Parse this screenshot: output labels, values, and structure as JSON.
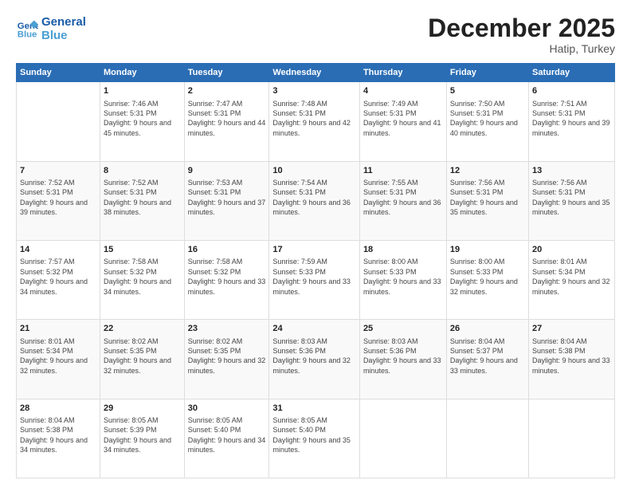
{
  "header": {
    "logo_line1": "General",
    "logo_line2": "Blue",
    "title": "December 2025",
    "subtitle": "Hatip, Turkey"
  },
  "days_of_week": [
    "Sunday",
    "Monday",
    "Tuesday",
    "Wednesday",
    "Thursday",
    "Friday",
    "Saturday"
  ],
  "weeks": [
    [
      {
        "day": "",
        "sunrise": "",
        "sunset": "",
        "daylight": ""
      },
      {
        "day": "1",
        "sunrise": "Sunrise: 7:46 AM",
        "sunset": "Sunset: 5:31 PM",
        "daylight": "Daylight: 9 hours and 45 minutes."
      },
      {
        "day": "2",
        "sunrise": "Sunrise: 7:47 AM",
        "sunset": "Sunset: 5:31 PM",
        "daylight": "Daylight: 9 hours and 44 minutes."
      },
      {
        "day": "3",
        "sunrise": "Sunrise: 7:48 AM",
        "sunset": "Sunset: 5:31 PM",
        "daylight": "Daylight: 9 hours and 42 minutes."
      },
      {
        "day": "4",
        "sunrise": "Sunrise: 7:49 AM",
        "sunset": "Sunset: 5:31 PM",
        "daylight": "Daylight: 9 hours and 41 minutes."
      },
      {
        "day": "5",
        "sunrise": "Sunrise: 7:50 AM",
        "sunset": "Sunset: 5:31 PM",
        "daylight": "Daylight: 9 hours and 40 minutes."
      },
      {
        "day": "6",
        "sunrise": "Sunrise: 7:51 AM",
        "sunset": "Sunset: 5:31 PM",
        "daylight": "Daylight: 9 hours and 39 minutes."
      }
    ],
    [
      {
        "day": "7",
        "sunrise": "Sunrise: 7:52 AM",
        "sunset": "Sunset: 5:31 PM",
        "daylight": "Daylight: 9 hours and 39 minutes."
      },
      {
        "day": "8",
        "sunrise": "Sunrise: 7:52 AM",
        "sunset": "Sunset: 5:31 PM",
        "daylight": "Daylight: 9 hours and 38 minutes."
      },
      {
        "day": "9",
        "sunrise": "Sunrise: 7:53 AM",
        "sunset": "Sunset: 5:31 PM",
        "daylight": "Daylight: 9 hours and 37 minutes."
      },
      {
        "day": "10",
        "sunrise": "Sunrise: 7:54 AM",
        "sunset": "Sunset: 5:31 PM",
        "daylight": "Daylight: 9 hours and 36 minutes."
      },
      {
        "day": "11",
        "sunrise": "Sunrise: 7:55 AM",
        "sunset": "Sunset: 5:31 PM",
        "daylight": "Daylight: 9 hours and 36 minutes."
      },
      {
        "day": "12",
        "sunrise": "Sunrise: 7:56 AM",
        "sunset": "Sunset: 5:31 PM",
        "daylight": "Daylight: 9 hours and 35 minutes."
      },
      {
        "day": "13",
        "sunrise": "Sunrise: 7:56 AM",
        "sunset": "Sunset: 5:31 PM",
        "daylight": "Daylight: 9 hours and 35 minutes."
      }
    ],
    [
      {
        "day": "14",
        "sunrise": "Sunrise: 7:57 AM",
        "sunset": "Sunset: 5:32 PM",
        "daylight": "Daylight: 9 hours and 34 minutes."
      },
      {
        "day": "15",
        "sunrise": "Sunrise: 7:58 AM",
        "sunset": "Sunset: 5:32 PM",
        "daylight": "Daylight: 9 hours and 34 minutes."
      },
      {
        "day": "16",
        "sunrise": "Sunrise: 7:58 AM",
        "sunset": "Sunset: 5:32 PM",
        "daylight": "Daylight: 9 hours and 33 minutes."
      },
      {
        "day": "17",
        "sunrise": "Sunrise: 7:59 AM",
        "sunset": "Sunset: 5:33 PM",
        "daylight": "Daylight: 9 hours and 33 minutes."
      },
      {
        "day": "18",
        "sunrise": "Sunrise: 8:00 AM",
        "sunset": "Sunset: 5:33 PM",
        "daylight": "Daylight: 9 hours and 33 minutes."
      },
      {
        "day": "19",
        "sunrise": "Sunrise: 8:00 AM",
        "sunset": "Sunset: 5:33 PM",
        "daylight": "Daylight: 9 hours and 32 minutes."
      },
      {
        "day": "20",
        "sunrise": "Sunrise: 8:01 AM",
        "sunset": "Sunset: 5:34 PM",
        "daylight": "Daylight: 9 hours and 32 minutes."
      }
    ],
    [
      {
        "day": "21",
        "sunrise": "Sunrise: 8:01 AM",
        "sunset": "Sunset: 5:34 PM",
        "daylight": "Daylight: 9 hours and 32 minutes."
      },
      {
        "day": "22",
        "sunrise": "Sunrise: 8:02 AM",
        "sunset": "Sunset: 5:35 PM",
        "daylight": "Daylight: 9 hours and 32 minutes."
      },
      {
        "day": "23",
        "sunrise": "Sunrise: 8:02 AM",
        "sunset": "Sunset: 5:35 PM",
        "daylight": "Daylight: 9 hours and 32 minutes."
      },
      {
        "day": "24",
        "sunrise": "Sunrise: 8:03 AM",
        "sunset": "Sunset: 5:36 PM",
        "daylight": "Daylight: 9 hours and 32 minutes."
      },
      {
        "day": "25",
        "sunrise": "Sunrise: 8:03 AM",
        "sunset": "Sunset: 5:36 PM",
        "daylight": "Daylight: 9 hours and 33 minutes."
      },
      {
        "day": "26",
        "sunrise": "Sunrise: 8:04 AM",
        "sunset": "Sunset: 5:37 PM",
        "daylight": "Daylight: 9 hours and 33 minutes."
      },
      {
        "day": "27",
        "sunrise": "Sunrise: 8:04 AM",
        "sunset": "Sunset: 5:38 PM",
        "daylight": "Daylight: 9 hours and 33 minutes."
      }
    ],
    [
      {
        "day": "28",
        "sunrise": "Sunrise: 8:04 AM",
        "sunset": "Sunset: 5:38 PM",
        "daylight": "Daylight: 9 hours and 34 minutes."
      },
      {
        "day": "29",
        "sunrise": "Sunrise: 8:05 AM",
        "sunset": "Sunset: 5:39 PM",
        "daylight": "Daylight: 9 hours and 34 minutes."
      },
      {
        "day": "30",
        "sunrise": "Sunrise: 8:05 AM",
        "sunset": "Sunset: 5:40 PM",
        "daylight": "Daylight: 9 hours and 34 minutes."
      },
      {
        "day": "31",
        "sunrise": "Sunrise: 8:05 AM",
        "sunset": "Sunset: 5:40 PM",
        "daylight": "Daylight: 9 hours and 35 minutes."
      },
      {
        "day": "",
        "sunrise": "",
        "sunset": "",
        "daylight": ""
      },
      {
        "day": "",
        "sunrise": "",
        "sunset": "",
        "daylight": ""
      },
      {
        "day": "",
        "sunrise": "",
        "sunset": "",
        "daylight": ""
      }
    ]
  ]
}
